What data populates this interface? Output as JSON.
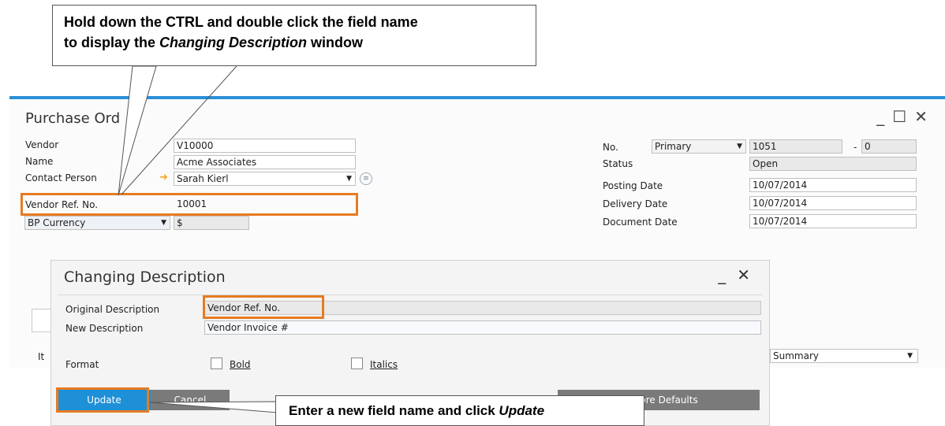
{
  "callouts": {
    "top_line1": "Hold down the CTRL and double click the field name",
    "top_line2_pre": "to display the ",
    "top_line2_em": "Changing Description",
    "top_line2_post": " window",
    "bottom_pre": "Enter a new field name and click ",
    "bottom_em": "Update"
  },
  "purchase_order": {
    "title": "Purchase Ord",
    "controls": {
      "minimize": "_",
      "maximize": "☐",
      "close": "✕"
    },
    "left_fields": {
      "vendor_label": "Vendor",
      "vendor_value": "V10000",
      "name_label": "Name",
      "name_value": "Acme Associates",
      "contact_label": "Contact Person",
      "contact_value": "Sarah Kierl",
      "vendor_ref_label": "Vendor Ref. No.",
      "vendor_ref_value": "10001",
      "currency_label": "BP Currency",
      "currency_value": "$"
    },
    "right_fields": {
      "no_label": "No.",
      "series_value": "Primary",
      "no_value": "1051",
      "no_suffix_sep": "-",
      "no_suffix_value": "0",
      "status_label": "Status",
      "status_value": "Open",
      "posting_label": "Posting Date",
      "posting_value": "10/07/2014",
      "delivery_label": "Delivery Date",
      "delivery_value": "10/07/2014",
      "document_label": "Document Date",
      "document_value": "10/07/2014"
    },
    "summary_select": "Summary",
    "tab_fragment": "It"
  },
  "dialog": {
    "title": "Changing Description",
    "controls": {
      "minimize": "_",
      "close": "✕"
    },
    "original_label": "Original Description",
    "original_value": "Vendor Ref. No.",
    "new_label": "New Description",
    "new_value": "Vendor Invoice #",
    "format_label": "Format",
    "bold_label": "Bold",
    "italics_label": "Italics",
    "update_button": "Update",
    "cancel_button": "Cancel",
    "restore_button": "Restore Defaults"
  },
  "colors": {
    "accent": "#2a8fd6",
    "highlight": "#e77b22",
    "update_button": "#1e90d8",
    "secondary_button": "#7a7a7a",
    "arrow": "#f5a623"
  }
}
